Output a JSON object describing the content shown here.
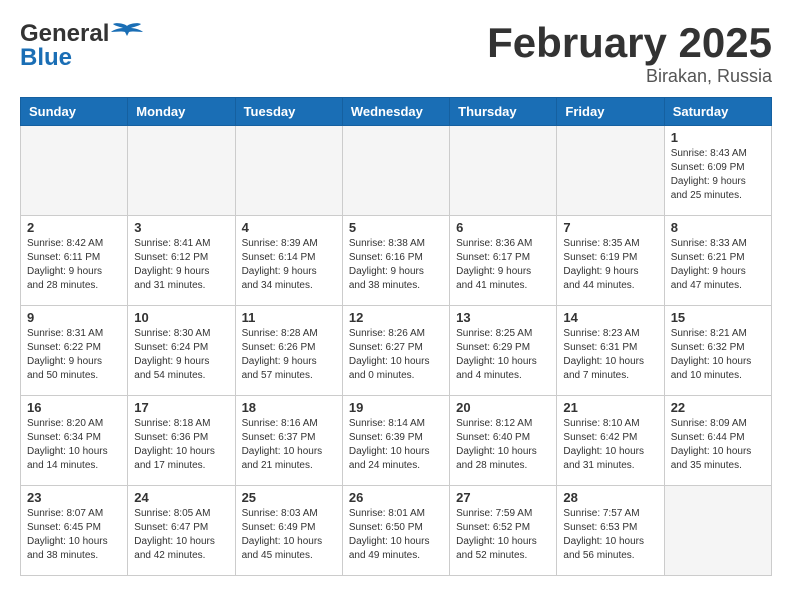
{
  "header": {
    "logo_general": "General",
    "logo_blue": "Blue",
    "month_title": "February 2025",
    "subtitle": "Birakan, Russia"
  },
  "weekdays": [
    "Sunday",
    "Monday",
    "Tuesday",
    "Wednesday",
    "Thursday",
    "Friday",
    "Saturday"
  ],
  "weeks": [
    [
      {
        "day": "",
        "info": ""
      },
      {
        "day": "",
        "info": ""
      },
      {
        "day": "",
        "info": ""
      },
      {
        "day": "",
        "info": ""
      },
      {
        "day": "",
        "info": ""
      },
      {
        "day": "",
        "info": ""
      },
      {
        "day": "1",
        "info": "Sunrise: 8:43 AM\nSunset: 6:09 PM\nDaylight: 9 hours and 25 minutes."
      }
    ],
    [
      {
        "day": "2",
        "info": "Sunrise: 8:42 AM\nSunset: 6:11 PM\nDaylight: 9 hours and 28 minutes."
      },
      {
        "day": "3",
        "info": "Sunrise: 8:41 AM\nSunset: 6:12 PM\nDaylight: 9 hours and 31 minutes."
      },
      {
        "day": "4",
        "info": "Sunrise: 8:39 AM\nSunset: 6:14 PM\nDaylight: 9 hours and 34 minutes."
      },
      {
        "day": "5",
        "info": "Sunrise: 8:38 AM\nSunset: 6:16 PM\nDaylight: 9 hours and 38 minutes."
      },
      {
        "day": "6",
        "info": "Sunrise: 8:36 AM\nSunset: 6:17 PM\nDaylight: 9 hours and 41 minutes."
      },
      {
        "day": "7",
        "info": "Sunrise: 8:35 AM\nSunset: 6:19 PM\nDaylight: 9 hours and 44 minutes."
      },
      {
        "day": "8",
        "info": "Sunrise: 8:33 AM\nSunset: 6:21 PM\nDaylight: 9 hours and 47 minutes."
      }
    ],
    [
      {
        "day": "9",
        "info": "Sunrise: 8:31 AM\nSunset: 6:22 PM\nDaylight: 9 hours and 50 minutes."
      },
      {
        "day": "10",
        "info": "Sunrise: 8:30 AM\nSunset: 6:24 PM\nDaylight: 9 hours and 54 minutes."
      },
      {
        "day": "11",
        "info": "Sunrise: 8:28 AM\nSunset: 6:26 PM\nDaylight: 9 hours and 57 minutes."
      },
      {
        "day": "12",
        "info": "Sunrise: 8:26 AM\nSunset: 6:27 PM\nDaylight: 10 hours and 0 minutes."
      },
      {
        "day": "13",
        "info": "Sunrise: 8:25 AM\nSunset: 6:29 PM\nDaylight: 10 hours and 4 minutes."
      },
      {
        "day": "14",
        "info": "Sunrise: 8:23 AM\nSunset: 6:31 PM\nDaylight: 10 hours and 7 minutes."
      },
      {
        "day": "15",
        "info": "Sunrise: 8:21 AM\nSunset: 6:32 PM\nDaylight: 10 hours and 10 minutes."
      }
    ],
    [
      {
        "day": "16",
        "info": "Sunrise: 8:20 AM\nSunset: 6:34 PM\nDaylight: 10 hours and 14 minutes."
      },
      {
        "day": "17",
        "info": "Sunrise: 8:18 AM\nSunset: 6:36 PM\nDaylight: 10 hours and 17 minutes."
      },
      {
        "day": "18",
        "info": "Sunrise: 8:16 AM\nSunset: 6:37 PM\nDaylight: 10 hours and 21 minutes."
      },
      {
        "day": "19",
        "info": "Sunrise: 8:14 AM\nSunset: 6:39 PM\nDaylight: 10 hours and 24 minutes."
      },
      {
        "day": "20",
        "info": "Sunrise: 8:12 AM\nSunset: 6:40 PM\nDaylight: 10 hours and 28 minutes."
      },
      {
        "day": "21",
        "info": "Sunrise: 8:10 AM\nSunset: 6:42 PM\nDaylight: 10 hours and 31 minutes."
      },
      {
        "day": "22",
        "info": "Sunrise: 8:09 AM\nSunset: 6:44 PM\nDaylight: 10 hours and 35 minutes."
      }
    ],
    [
      {
        "day": "23",
        "info": "Sunrise: 8:07 AM\nSunset: 6:45 PM\nDaylight: 10 hours and 38 minutes."
      },
      {
        "day": "24",
        "info": "Sunrise: 8:05 AM\nSunset: 6:47 PM\nDaylight: 10 hours and 42 minutes."
      },
      {
        "day": "25",
        "info": "Sunrise: 8:03 AM\nSunset: 6:49 PM\nDaylight: 10 hours and 45 minutes."
      },
      {
        "day": "26",
        "info": "Sunrise: 8:01 AM\nSunset: 6:50 PM\nDaylight: 10 hours and 49 minutes."
      },
      {
        "day": "27",
        "info": "Sunrise: 7:59 AM\nSunset: 6:52 PM\nDaylight: 10 hours and 52 minutes."
      },
      {
        "day": "28",
        "info": "Sunrise: 7:57 AM\nSunset: 6:53 PM\nDaylight: 10 hours and 56 minutes."
      },
      {
        "day": "",
        "info": ""
      }
    ]
  ]
}
